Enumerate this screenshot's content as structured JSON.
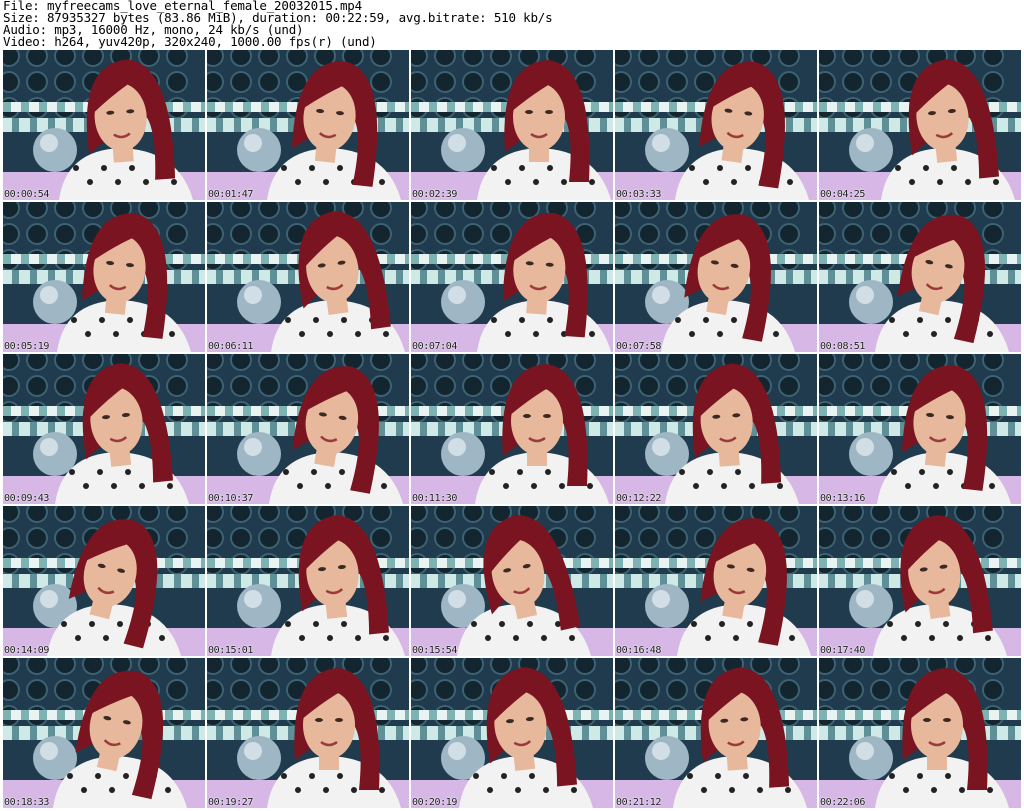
{
  "header": {
    "file": "File: myfreecams_love_eternal_female_20032015.mp4",
    "size": "Size: 87935327 bytes (83.86 MiB), duration: 00:22:59, avg.bitrate: 510 kb/s",
    "audio": "Audio: mp3, 16000 Hz, mono, 24 kb/s (und)",
    "video": "Video: h264, yuv420p, 320x240, 1000.00 fps(r) (und)"
  },
  "colors": {
    "background": "#ffffff",
    "wall": "#1f3b4d",
    "hair": "#7a1420",
    "skin": "#e8b89c",
    "shirt": "#f2f2f2",
    "couch": "#d6b7e6"
  },
  "thumbnails": [
    {
      "timestamp": "00:00:54"
    },
    {
      "timestamp": "00:01:47"
    },
    {
      "timestamp": "00:02:39"
    },
    {
      "timestamp": "00:03:33"
    },
    {
      "timestamp": "00:04:25"
    },
    {
      "timestamp": "00:05:19"
    },
    {
      "timestamp": "00:06:11"
    },
    {
      "timestamp": "00:07:04"
    },
    {
      "timestamp": "00:07:58"
    },
    {
      "timestamp": "00:08:51"
    },
    {
      "timestamp": "00:09:43"
    },
    {
      "timestamp": "00:10:37"
    },
    {
      "timestamp": "00:11:30"
    },
    {
      "timestamp": "00:12:22"
    },
    {
      "timestamp": "00:13:16"
    },
    {
      "timestamp": "00:14:09"
    },
    {
      "timestamp": "00:15:01"
    },
    {
      "timestamp": "00:15:54"
    },
    {
      "timestamp": "00:16:48"
    },
    {
      "timestamp": "00:17:40"
    },
    {
      "timestamp": "00:18:33"
    },
    {
      "timestamp": "00:19:27"
    },
    {
      "timestamp": "00:20:19"
    },
    {
      "timestamp": "00:21:12"
    },
    {
      "timestamp": "00:22:06"
    }
  ]
}
